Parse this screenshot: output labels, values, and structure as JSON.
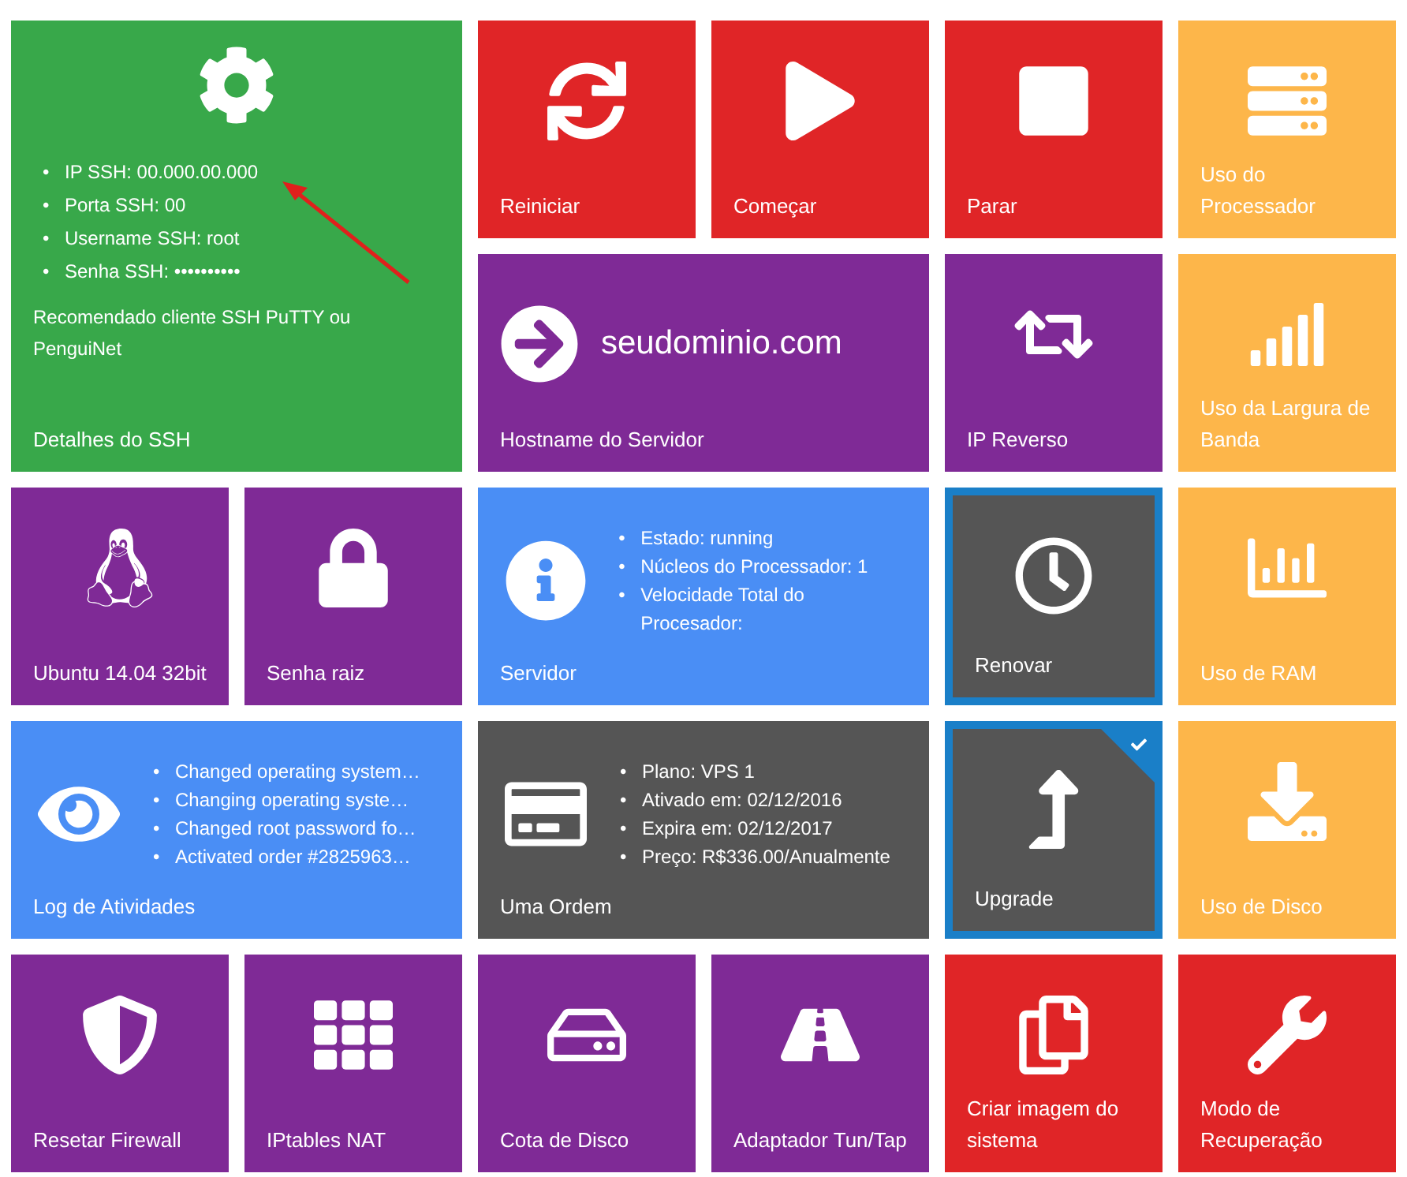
{
  "bullet": "•",
  "tiles": [
    {
      "kind": "ssh",
      "title": "Detalhes do SSH",
      "color": "#38a84a",
      "wide": true,
      "tall": true,
      "highlighted": false,
      "checked": false,
      "items": [
        "IP SSH: 00.000.00.000",
        "Porta SSH: 00",
        "Username SSH: root",
        "Senha SSH: ••••••••••"
      ],
      "note": "Recomendado cliente SSH PuTTY ou PenguiNet"
    },
    {
      "kind": "icon",
      "title": "Reiniciar",
      "color": "#e02527",
      "wide": false,
      "tall": false,
      "highlighted": false,
      "checked": false
    },
    {
      "kind": "icon",
      "title": "Começar",
      "color": "#e02527",
      "wide": false,
      "tall": false,
      "highlighted": false,
      "checked": false
    },
    {
      "kind": "icon",
      "title": "Parar",
      "color": "#e02527",
      "wide": false,
      "tall": false,
      "highlighted": false,
      "checked": false
    },
    {
      "kind": "icon",
      "title": "Uso do Processador",
      "color": "#fdb64a",
      "wide": false,
      "tall": false,
      "highlighted": false,
      "checked": false
    },
    {
      "kind": "domain",
      "title": "Hostname do Servidor",
      "color": "#7f2a96",
      "wide": true,
      "tall": false,
      "highlighted": false,
      "checked": false,
      "domain": "seudominio.com"
    },
    {
      "kind": "icon",
      "title": "IP Reverso",
      "color": "#7f2a96",
      "wide": false,
      "tall": false,
      "highlighted": false,
      "checked": false
    },
    {
      "kind": "icon",
      "title": "Uso da Largura de Banda",
      "color": "#fdb64a",
      "wide": false,
      "tall": false,
      "highlighted": false,
      "checked": false
    },
    {
      "kind": "icon",
      "title": "Ubuntu 14.04 32bit",
      "color": "#7f2a96",
      "wide": false,
      "tall": false,
      "highlighted": false,
      "checked": false
    },
    {
      "kind": "icon",
      "title": "Senha raiz",
      "color": "#7f2a96",
      "wide": false,
      "tall": false,
      "highlighted": false,
      "checked": false
    },
    {
      "kind": "details",
      "title": "Servidor",
      "color": "#4a8ef5",
      "wide": true,
      "tall": false,
      "highlighted": false,
      "checked": false,
      "items": [
        "Estado: running",
        "Núcleos do Processador: 1",
        "Velocidade Total do Procesador:"
      ]
    },
    {
      "kind": "icon",
      "title": "Renovar",
      "color": "#555555",
      "wide": false,
      "tall": false,
      "highlighted": true,
      "checked": false
    },
    {
      "kind": "icon",
      "title": "Uso de RAM",
      "color": "#fdb64a",
      "wide": false,
      "tall": false,
      "highlighted": false,
      "checked": false
    },
    {
      "kind": "details",
      "title": "Log de Atividades",
      "color": "#4a8ef5",
      "wide": true,
      "tall": false,
      "highlighted": false,
      "checked": false,
      "items": [
        "Changed operating system…",
        "Changing operating syste…",
        "Changed root password fo…",
        "Activated order #2825963…"
      ]
    },
    {
      "kind": "details",
      "title": "Uma Ordem",
      "color": "#555555",
      "wide": true,
      "tall": false,
      "highlighted": false,
      "checked": false,
      "items": [
        "Plano: VPS 1",
        "Ativado em: 02/12/2016",
        "Expira em: 02/12/2017",
        "Preço: R$336.00/Anualmente"
      ]
    },
    {
      "kind": "icon",
      "title": "Upgrade",
      "color": "#555555",
      "wide": false,
      "tall": false,
      "highlighted": true,
      "checked": true
    },
    {
      "kind": "icon",
      "title": "Uso de Disco",
      "color": "#fdb64a",
      "wide": false,
      "tall": false,
      "highlighted": false,
      "checked": false
    },
    {
      "kind": "icon",
      "title": "Resetar Firewall",
      "color": "#7f2a96",
      "wide": false,
      "tall": false,
      "highlighted": false,
      "checked": false
    },
    {
      "kind": "icon",
      "title": "IPtables NAT",
      "color": "#7f2a96",
      "wide": false,
      "tall": false,
      "highlighted": false,
      "checked": false
    },
    {
      "kind": "icon",
      "title": "Cota de Disco",
      "color": "#7f2a96",
      "wide": false,
      "tall": false,
      "highlighted": false,
      "checked": false
    },
    {
      "kind": "icon",
      "title": "Adaptador Tun/Tap",
      "color": "#7f2a96",
      "wide": false,
      "tall": false,
      "highlighted": false,
      "checked": false
    },
    {
      "kind": "icon",
      "title": "Criar imagem do sistema",
      "color": "#e02527",
      "wide": false,
      "tall": false,
      "highlighted": false,
      "checked": false
    },
    {
      "kind": "icon",
      "title": "Modo de Recuperação",
      "color": "#e02527",
      "wide": false,
      "tall": false,
      "highlighted": false,
      "checked": false
    }
  ]
}
